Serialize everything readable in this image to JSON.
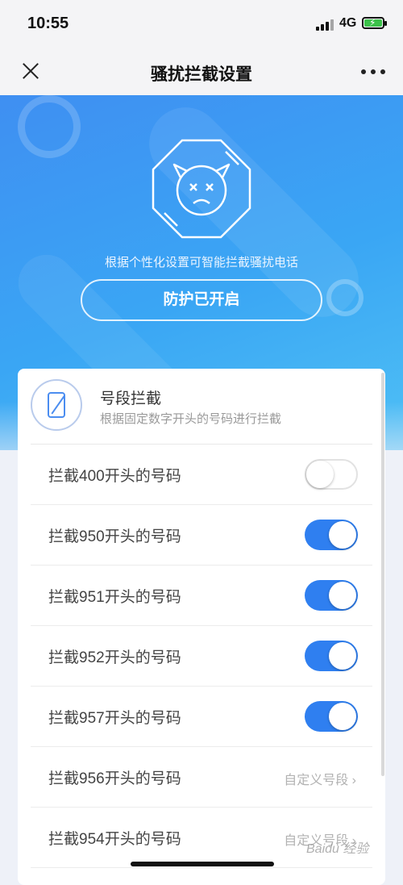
{
  "status": {
    "time": "10:55",
    "network": "4G"
  },
  "nav": {
    "title": "骚扰拦截设置"
  },
  "hero": {
    "subtitle": "根据个性化设置可智能拦截骚扰电话",
    "button": "防护已开启"
  },
  "card": {
    "title": "号段拦截",
    "desc": "根据固定数字开头的号码进行拦截",
    "rows": [
      {
        "label": "拦截400开头的号码",
        "type": "toggle",
        "on": false
      },
      {
        "label": "拦截950开头的号码",
        "type": "toggle",
        "on": true
      },
      {
        "label": "拦截951开头的号码",
        "type": "toggle",
        "on": true
      },
      {
        "label": "拦截952开头的号码",
        "type": "toggle",
        "on": true
      },
      {
        "label": "拦截957开头的号码",
        "type": "toggle",
        "on": true
      },
      {
        "label": "拦截956开头的号码",
        "type": "custom",
        "action": "自定义号段 ›"
      },
      {
        "label": "拦截954开头的号码",
        "type": "custom",
        "action": "自定义号段 ›"
      }
    ]
  },
  "watermark": "Baidu 经验",
  "colors": {
    "accent": "#2f7ff0",
    "hero_start": "#3f8ff2",
    "hero_end": "#4fc0f5"
  }
}
